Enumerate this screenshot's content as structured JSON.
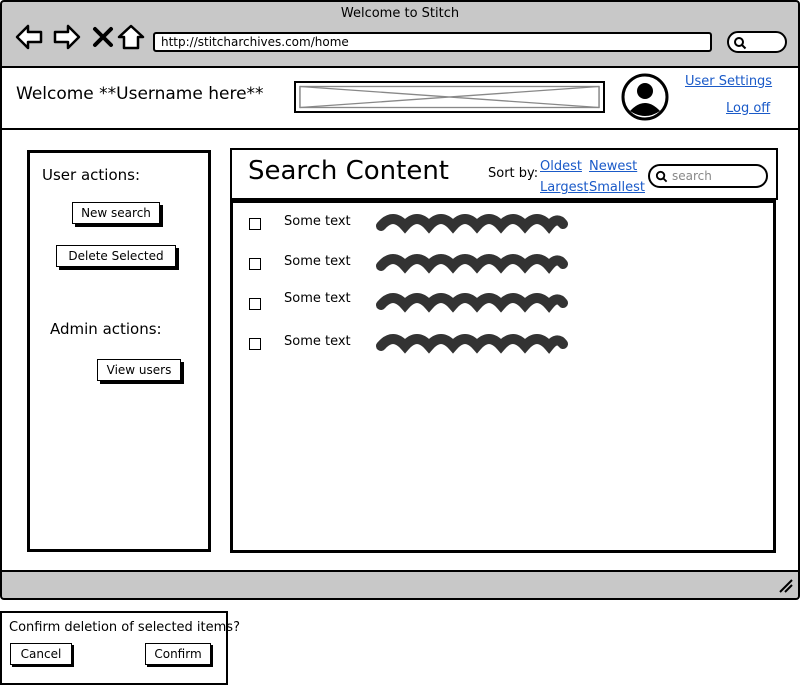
{
  "browser": {
    "title": "Welcome to Stitch",
    "url": "http://stitcharchives.com/home",
    "icons": [
      "back-arrow-icon",
      "forward-arrow-icon",
      "close-x-icon",
      "home-icon",
      "search-icon",
      "resize-grip-icon"
    ]
  },
  "header": {
    "welcome": "Welcome **Username here**",
    "user_settings": "User Settings",
    "log_off": "Log off",
    "avatar_icon": "user-avatar-icon"
  },
  "sidebar": {
    "user_actions_label": "User actions:",
    "new_search": "New search",
    "delete_selected": "Delete Selected",
    "admin_actions_label": "Admin actions:",
    "view_users": "View users"
  },
  "main": {
    "title": "Search Content",
    "sort_label": "Sort by:",
    "sort_options": [
      "Oldest",
      "Newest",
      "Largest",
      "Smallest"
    ],
    "search_placeholder": "search",
    "rows": [
      {
        "text": "Some text"
      },
      {
        "text": "Some text"
      },
      {
        "text": "Some text"
      },
      {
        "text": "Some text"
      }
    ]
  },
  "dialog": {
    "message": "Confirm deletion of selected items?",
    "cancel": "Cancel",
    "confirm": "Confirm"
  }
}
